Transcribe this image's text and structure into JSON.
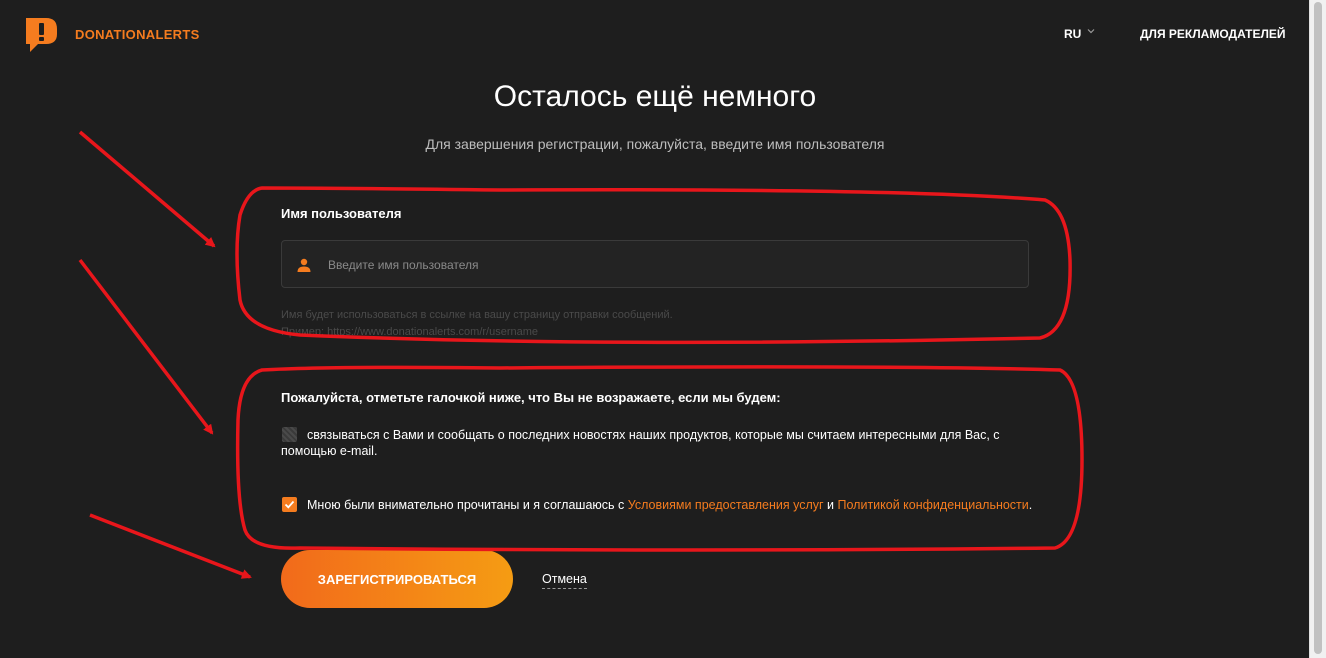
{
  "header": {
    "brand": "DONATIONALERTS",
    "language": "RU",
    "advertisers_link": "ДЛЯ РЕКЛАМОДАТЕЛЕЙ"
  },
  "main": {
    "title": "Осталось ещё немного",
    "subtitle": "Для завершения регистрации, пожалуйста, введите имя пользователя"
  },
  "username": {
    "label": "Имя пользователя",
    "placeholder": "Введите имя пользователя",
    "value": "",
    "hint_line1": "Имя будет использоваться в ссылке на вашу страницу отправки сообщений.",
    "hint_line2": "Пример: https://www.donationalerts.com/r/username"
  },
  "consent": {
    "title": "Пожалуйста, отметьте галочкой ниже, что Вы не возражаете, если мы будем:",
    "option_email": {
      "text": "связываться с Вами и сообщать о последних новостях наших продуктов, которые мы считаем интересными для Вас, с помощью e-mail.",
      "checked": false
    },
    "option_terms": {
      "prefix": "Мною были внимательно прочитаны и я соглашаюсь с",
      "terms_link": "Условиями предоставления услуг",
      "conjunction": "и",
      "privacy_link": "Политикой конфиденциальности",
      "suffix": ".",
      "checked": true
    }
  },
  "actions": {
    "register": "ЗАРЕГИСТРИРОВАТЬСЯ",
    "cancel": "Отмена"
  },
  "colors": {
    "background": "#1e1e1e",
    "accent": "#f57c1f",
    "annotation": "#e8161b"
  },
  "icons": {
    "logo": "donationalerts-logo-icon",
    "language_dropdown": "chevron-down-icon",
    "username_field": "user-icon",
    "checkbox_checked": "check-icon"
  }
}
